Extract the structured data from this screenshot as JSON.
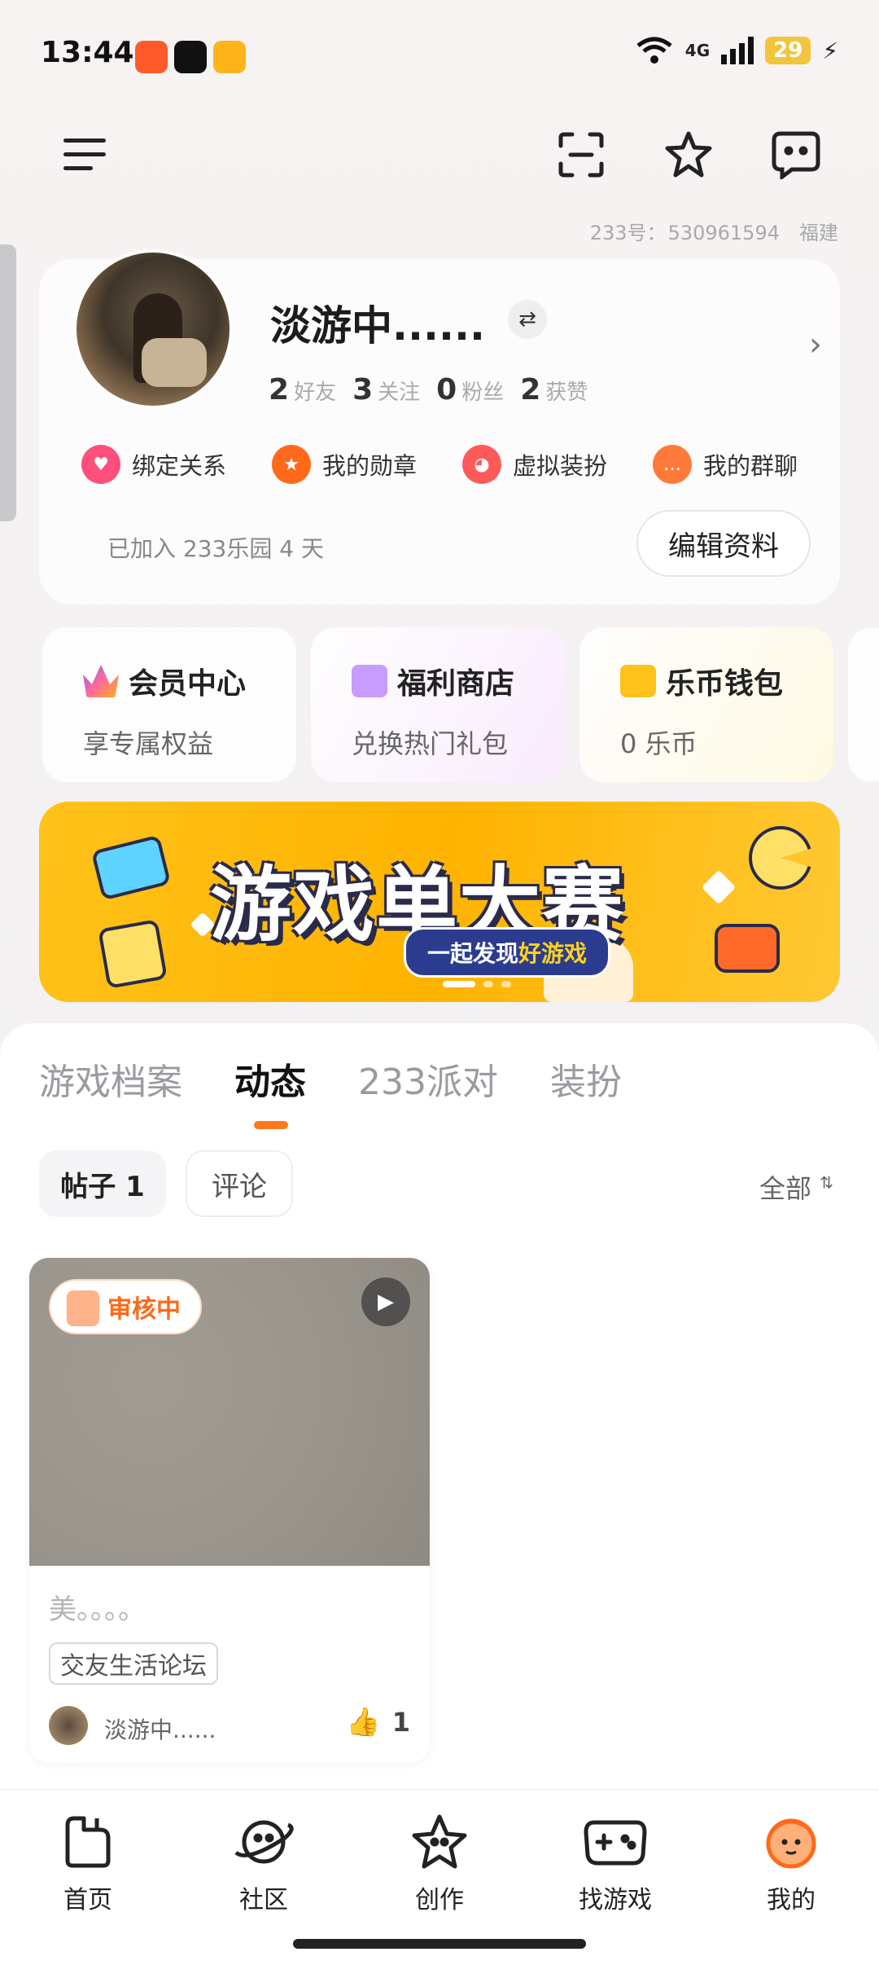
{
  "status_bar": {
    "time": "13:44",
    "network": "4G",
    "battery": "29"
  },
  "account": {
    "id_label": "233号：",
    "id_value": "530961594",
    "region": "福建"
  },
  "profile": {
    "name": "淡游中......",
    "stats": [
      {
        "num": "2",
        "label": "好友"
      },
      {
        "num": "3",
        "label": "关注"
      },
      {
        "num": "0",
        "label": "粉丝"
      },
      {
        "num": "2",
        "label": "获赞"
      }
    ],
    "quick_links": [
      {
        "label": "绑定关系",
        "color": "#ff4f7b"
      },
      {
        "label": "我的勋章",
        "color": "#ff6a1a"
      },
      {
        "label": "虚拟装扮",
        "color": "#ff5a5a"
      },
      {
        "label": "我的群聊",
        "color": "#ff7a3a"
      }
    ],
    "joined": "已加入 233乐园 4 天",
    "edit_label": "编辑资料"
  },
  "features": [
    {
      "title": "会员中心",
      "sub": "享专属权益",
      "icon_color": "#8a5cff"
    },
    {
      "title": "福利商店",
      "sub": "兑换热门礼包",
      "icon_color": "#c89bff"
    },
    {
      "title": "乐币钱包",
      "sub": "0 乐币",
      "icon_color": "#ffc21a"
    }
  ],
  "banner": {
    "title": "游戏单大赛",
    "sub_a": "一起发现",
    "sub_b": "好游戏"
  },
  "tabs": [
    "游戏档案",
    "动态",
    "233派对",
    "装扮"
  ],
  "active_tab": "动态",
  "filters": {
    "posts": "帖子 1",
    "comments": "评论",
    "sort": "全部"
  },
  "post": {
    "status": "审核中",
    "text": "美。。。。",
    "tag": "交友生活论坛",
    "author": "淡游中......",
    "likes": "1"
  },
  "bottom_nav": [
    {
      "label": "首页",
      "icon": "home-icon"
    },
    {
      "label": "社区",
      "icon": "planet-icon"
    },
    {
      "label": "创作",
      "icon": "star-icon"
    },
    {
      "label": "找游戏",
      "icon": "gamepad-icon"
    },
    {
      "label": "我的",
      "icon": "mine-icon"
    }
  ],
  "colors": {
    "accent": "#ff7a1a",
    "banner": "#ffb300"
  }
}
